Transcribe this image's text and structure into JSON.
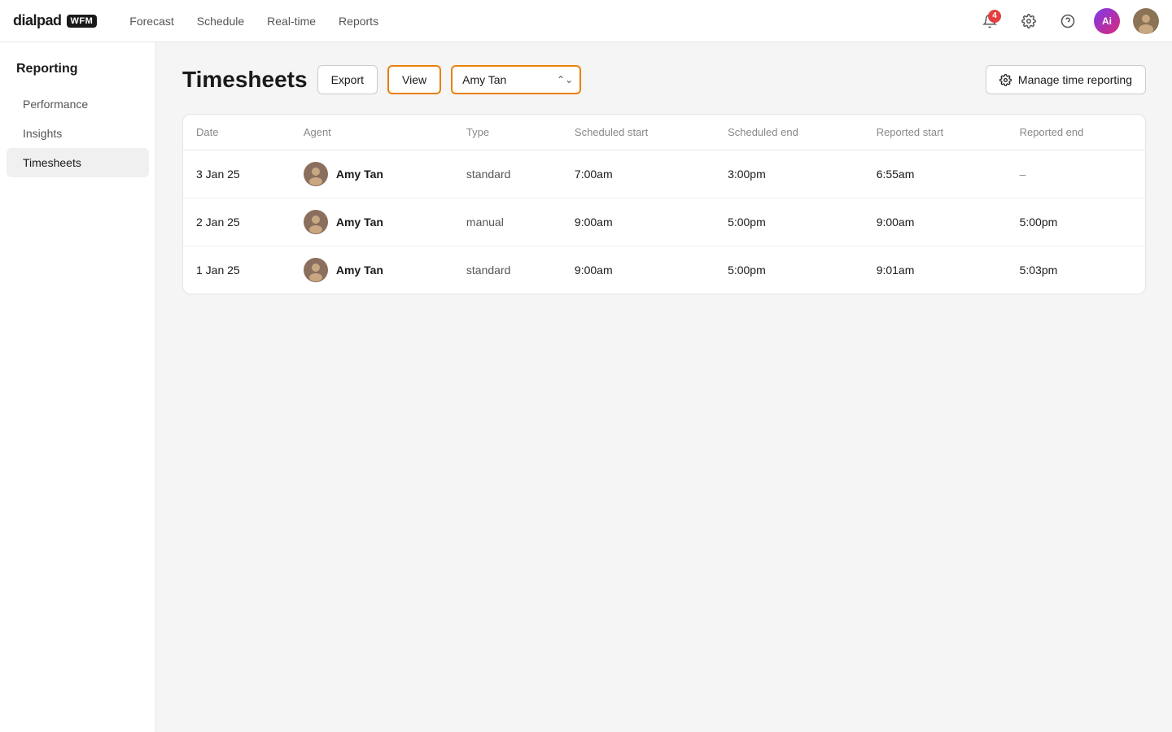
{
  "app": {
    "logo_text": "dialpad",
    "wfm_label": "WFM",
    "ai_label": "Ai"
  },
  "topnav": {
    "links": [
      {
        "id": "forecast",
        "label": "Forecast"
      },
      {
        "id": "schedule",
        "label": "Schedule"
      },
      {
        "id": "realtime",
        "label": "Real-time"
      },
      {
        "id": "reports",
        "label": "Reports"
      }
    ],
    "notification_count": "4"
  },
  "sidebar": {
    "section_title": "Reporting",
    "items": [
      {
        "id": "performance",
        "label": "Performance"
      },
      {
        "id": "insights",
        "label": "Insights"
      },
      {
        "id": "timesheets",
        "label": "Timesheets",
        "active": true
      }
    ]
  },
  "page": {
    "title": "Timesheets",
    "export_label": "Export",
    "view_label": "View",
    "agent_select_value": "Amy Tan",
    "manage_label": "Manage time reporting",
    "table": {
      "columns": [
        "Date",
        "Agent",
        "Type",
        "Scheduled start",
        "Scheduled end",
        "Reported start",
        "Reported end"
      ],
      "rows": [
        {
          "date": "3 Jan 25",
          "agent": "Amy Tan",
          "type": "standard",
          "scheduled_start": "7:00am",
          "scheduled_end": "3:00pm",
          "reported_start": "6:55am",
          "reported_end": "–"
        },
        {
          "date": "2 Jan 25",
          "agent": "Amy Tan",
          "type": "manual",
          "scheduled_start": "9:00am",
          "scheduled_end": "5:00pm",
          "reported_start": "9:00am",
          "reported_end": "5:00pm"
        },
        {
          "date": "1 Jan 25",
          "agent": "Amy Tan",
          "type": "standard",
          "scheduled_start": "9:00am",
          "scheduled_end": "5:00pm",
          "reported_start": "9:01am",
          "reported_end": "5:03pm"
        }
      ]
    }
  }
}
